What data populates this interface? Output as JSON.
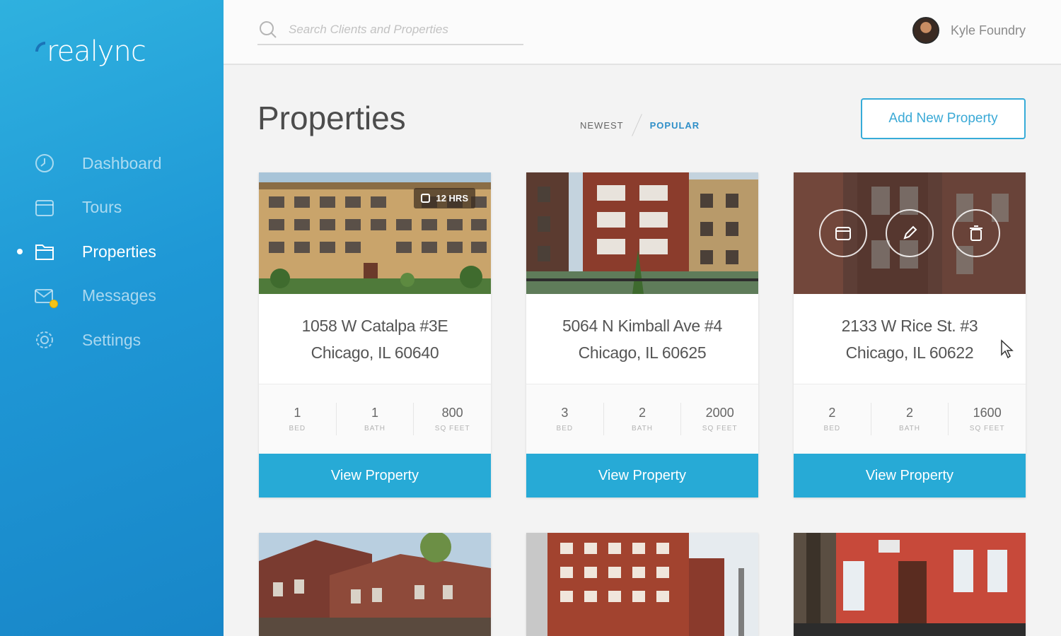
{
  "sidebar": {
    "brand": "realync",
    "items": [
      {
        "label": "Dashboard",
        "icon": "clock-icon",
        "active": false
      },
      {
        "label": "Tours",
        "icon": "calendar-icon",
        "active": false
      },
      {
        "label": "Properties",
        "icon": "folder-icon",
        "active": true
      },
      {
        "label": "Messages",
        "icon": "mail-icon",
        "active": false,
        "badge": true
      },
      {
        "label": "Settings",
        "icon": "gear-icon",
        "active": false
      }
    ]
  },
  "topbar": {
    "search_placeholder": "Search Clients and Properties",
    "user_name": "Kyle Foundry"
  },
  "main": {
    "title": "Properties",
    "sort_tabs": [
      {
        "label": "NEWEST",
        "active": false
      },
      {
        "label": "POPULAR",
        "active": true
      }
    ],
    "add_button": "Add New Property"
  },
  "cards": [
    {
      "address_line1": "1058 W Catalpa #3E",
      "address_line2": "Chicago, IL 60640",
      "tag": "12 HRS",
      "stats": [
        {
          "value": "1",
          "label": "BED"
        },
        {
          "value": "1",
          "label": "BATH"
        },
        {
          "value": "800",
          "label": "SQ FEET"
        }
      ],
      "button": "View Property"
    },
    {
      "address_line1": "5064 N Kimball Ave #4",
      "address_line2": "Chicago, IL 60625",
      "stats": [
        {
          "value": "3",
          "label": "BED"
        },
        {
          "value": "2",
          "label": "BATH"
        },
        {
          "value": "2000",
          "label": "SQ FEET"
        }
      ],
      "button": "View Property"
    },
    {
      "address_line1": "2133 W Rice St. #3",
      "address_line2": "Chicago, IL 60622",
      "stats": [
        {
          "value": "2",
          "label": "BED"
        },
        {
          "value": "2",
          "label": "BATH"
        },
        {
          "value": "1600",
          "label": "SQ FEET"
        }
      ],
      "button": "View Property",
      "overlay_icons": [
        "calendar-icon",
        "pencil-icon",
        "trash-icon"
      ]
    }
  ],
  "colors": {
    "sidebar": "#1f98d6",
    "accent": "#27aad6",
    "popular": "#2f8fc8"
  }
}
